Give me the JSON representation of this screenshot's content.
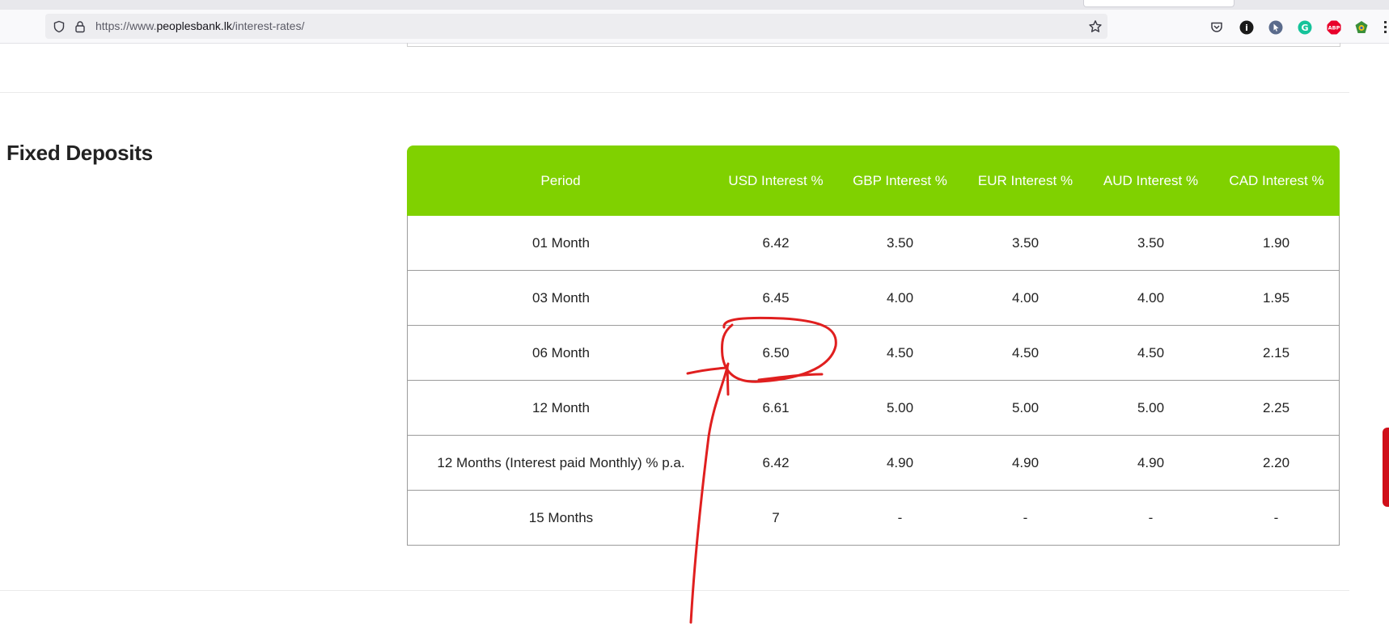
{
  "browser": {
    "url_prefix": "https://www.",
    "url_host": "peoplesbank.lk",
    "url_path": "/interest-rates/",
    "extensions": [
      {
        "name": "pocket-icon",
        "color": "#ffffff"
      },
      {
        "name": "info-extension-icon",
        "color": "#1a1a1a"
      },
      {
        "name": "cursor-extension-icon",
        "color": "#5a6b8c"
      },
      {
        "name": "grammarly-icon",
        "color": "#15c39a"
      },
      {
        "name": "adblock-plus-icon",
        "color": "#e8002a"
      },
      {
        "name": "globe-extension-icon",
        "color": "#3a8f3a"
      }
    ],
    "extension_labels": {
      "grammarly": "G",
      "adblock": "ABP",
      "info": "i"
    }
  },
  "section": {
    "title": "Fixed Deposits"
  },
  "table": {
    "headers": [
      "Period",
      "USD Interest %",
      "GBP Interest %",
      "EUR Interest %",
      "AUD Interest %",
      "CAD Interest %"
    ],
    "rows": [
      [
        "01 Month",
        "6.42",
        "3.50",
        "3.50",
        "3.50",
        "1.90"
      ],
      [
        "03 Month",
        "6.45",
        "4.00",
        "4.00",
        "4.00",
        "1.95"
      ],
      [
        "06 Month",
        "6.50",
        "4.50",
        "4.50",
        "4.50",
        "2.15"
      ],
      [
        "12 Month",
        "6.61",
        "5.00",
        "5.00",
        "5.00",
        "2.25"
      ],
      [
        "12 Months (Interest paid Monthly) % p.a.",
        "6.42",
        "4.90",
        "4.90",
        "4.90",
        "2.20"
      ],
      [
        "15 Months",
        "7",
        "-",
        "-",
        "-",
        "-"
      ]
    ]
  },
  "colors": {
    "header_green": "#80d100",
    "annotation_red": "#e01f1f"
  }
}
